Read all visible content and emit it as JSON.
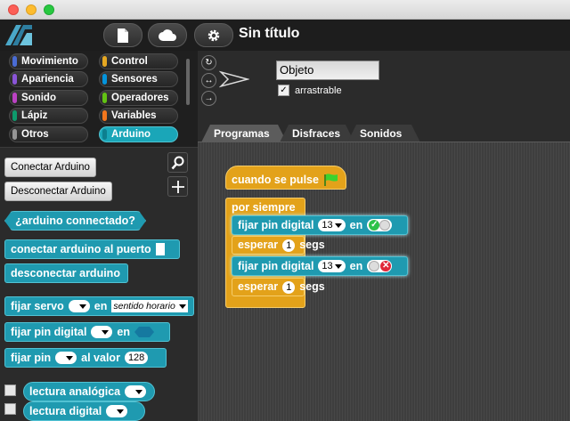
{
  "window": {
    "title": "Sin título"
  },
  "toolbar": {
    "file_icon": "file-icon",
    "cloud_icon": "cloud-icon",
    "settings_icon": "gear-icon"
  },
  "categories": [
    {
      "label": "Movimiento",
      "color": "#4a6cd4"
    },
    {
      "label": "Control",
      "color": "#e6a822"
    },
    {
      "label": "Apariencia",
      "color": "#8a55d7"
    },
    {
      "label": "Sensores",
      "color": "#0494dc"
    },
    {
      "label": "Sonido",
      "color": "#bb42c3"
    },
    {
      "label": "Operadores",
      "color": "#62c213"
    },
    {
      "label": "Lápiz",
      "color": "#0e9a6c"
    },
    {
      "label": "Variables",
      "color": "#f3761d"
    },
    {
      "label": "Otros",
      "color": "#969696"
    },
    {
      "label": "Arduino",
      "color": "#1aa6b8"
    }
  ],
  "palette": {
    "connect_button": "Conectar Arduino",
    "disconnect_button": "Desconectar Arduino",
    "blocks": {
      "connected": "¿arduino connectado?",
      "connect_port": "conectar arduino al puerto",
      "disconnect": "desconectar arduino",
      "set_servo": "fijar servo",
      "set_servo_in": "en",
      "servo_dir": "sentido horario",
      "set_digital": "fijar pin digital",
      "set_digital_in": "en",
      "set_pin": "fijar pin",
      "set_pin_value": "al valor",
      "pin_value": "128",
      "analog_read": "lectura analógica",
      "digital_read": "lectura digital"
    }
  },
  "sprite": {
    "name": "Objeto",
    "draggable_label": "arrastrable",
    "draggable_checked": "✓"
  },
  "tabs": [
    "Programas",
    "Disfraces",
    "Sonidos"
  ],
  "script": {
    "hat": "cuando se pulse",
    "forever": "por siempre",
    "set1": "fijar pin digital",
    "pin1": "13",
    "in1": "en",
    "wait1": "esperar",
    "wait1_val": "1",
    "wait1_unit": "segs",
    "set2": "fijar pin digital",
    "pin2": "13",
    "in2": "en",
    "wait2": "esperar",
    "wait2_val": "1",
    "wait2_unit": "segs"
  }
}
